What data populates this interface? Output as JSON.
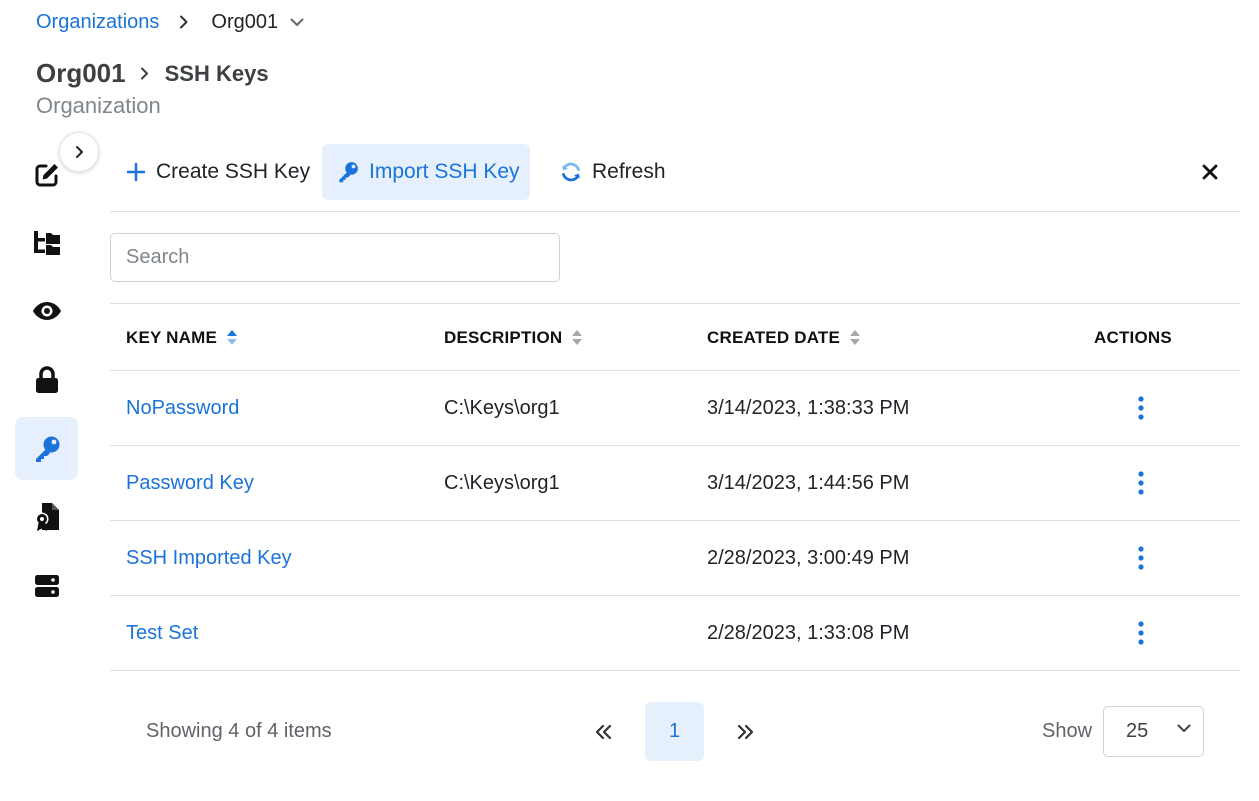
{
  "breadcrumb": {
    "root": "Organizations",
    "current": "Org001"
  },
  "header": {
    "org": "Org001",
    "page": "SSH Keys",
    "subtitle": "Organization"
  },
  "sidebar": {
    "items": [
      {
        "icon": "edit-icon",
        "active": false
      },
      {
        "icon": "hierarchy-icon",
        "active": false
      },
      {
        "icon": "eye-icon",
        "active": false
      },
      {
        "icon": "lock-icon",
        "active": false
      },
      {
        "icon": "key-icon",
        "active": true
      },
      {
        "icon": "certificate-icon",
        "active": false
      },
      {
        "icon": "server-icon",
        "active": false
      }
    ]
  },
  "toolbar": {
    "create_label": "Create SSH Key",
    "import_label": "Import SSH Key",
    "refresh_label": "Refresh"
  },
  "search": {
    "placeholder": "Search",
    "value": ""
  },
  "table": {
    "columns": [
      "KEY NAME",
      "DESCRIPTION",
      "CREATED DATE",
      "ACTIONS"
    ],
    "rows": [
      {
        "name": "NoPassword",
        "description": "C:\\Keys\\org1",
        "created": "3/14/2023, 1:38:33 PM"
      },
      {
        "name": "Password Key",
        "description": "C:\\Keys\\org1",
        "created": "3/14/2023, 1:44:56 PM"
      },
      {
        "name": "SSH Imported Key",
        "description": "",
        "created": "2/28/2023, 3:00:49 PM"
      },
      {
        "name": "Test Set",
        "description": "",
        "created": "2/28/2023, 1:33:08 PM"
      }
    ]
  },
  "pagination": {
    "info": "Showing 4 of 4 items",
    "current_page": "1",
    "show_label": "Show",
    "page_size": "25"
  },
  "colors": {
    "accent": "#1a73d9",
    "active_bg": "#e6f0fc",
    "divider": "#dde0e4"
  }
}
